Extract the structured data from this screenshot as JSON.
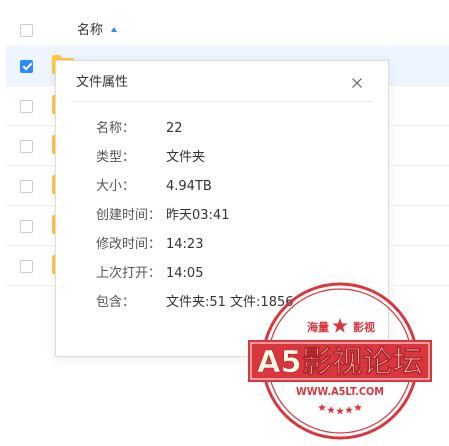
{
  "colors": {
    "accent": "#2b8cff",
    "selected_row_bg": "#eef5ff",
    "folder": "#ffc93c",
    "seal_red": "#d7262e",
    "text_primary": "#333333",
    "text_secondary": "#555555"
  },
  "file_list": {
    "header": {
      "name_label": "名称",
      "sort_icon": "sort-ascending-icon",
      "select_all_checked": false
    },
    "rows": [
      {
        "checked": true,
        "selected": true,
        "icon": "folder-icon"
      },
      {
        "checked": false,
        "selected": false,
        "icon": "folder-icon"
      },
      {
        "checked": false,
        "selected": false,
        "icon": "folder-icon"
      },
      {
        "checked": false,
        "selected": false,
        "icon": "folder-icon"
      },
      {
        "checked": false,
        "selected": false,
        "icon": "folder-icon"
      },
      {
        "checked": false,
        "selected": false,
        "icon": "folder-icon"
      }
    ]
  },
  "dialog": {
    "title": "文件属性",
    "close_icon": "close-icon",
    "properties": [
      {
        "label": "名称：",
        "value": "22"
      },
      {
        "label": "类型：",
        "value": "文件夹"
      },
      {
        "label": "大小：",
        "value": "4.94TB"
      },
      {
        "label": "创建时间：",
        "value": "昨天03:41"
      },
      {
        "label": "修改时间：",
        "value": "14:23"
      },
      {
        "label": "上次打开：",
        "value": "14:05"
      },
      {
        "label": "包含：",
        "value": "文件夹:51 文件:1856"
      }
    ]
  },
  "watermark": {
    "top_left_text": "海量",
    "top_right_text": "影视",
    "banner_text": "A5影视论坛",
    "url_text": "WWW.A5LT.COM",
    "star_icon": "star-icon"
  }
}
